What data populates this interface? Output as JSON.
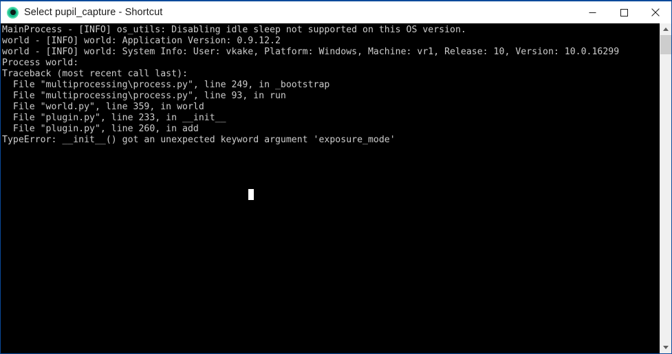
{
  "window": {
    "title": "Select pupil_capture - Shortcut",
    "icon": "pupil-circle-icon",
    "accent_border_color": "#0a4a9b",
    "titlebar_bg": "#ffffff",
    "console_bg": "#000000",
    "console_fg": "#cccccc"
  },
  "titlebar_buttons": {
    "minimize_label": "Minimize",
    "maximize_label": "Maximize",
    "close_label": "Close"
  },
  "console": {
    "lines": [
      "MainProcess - [INFO] os_utils: Disabling idle sleep not supported on this OS version.",
      "world - [INFO] world: Application Version: 0.9.12.2",
      "world - [INFO] world: System Info: User: vkake, Platform: Windows, Machine: vr1, Release: 10, Version: 10.0.16299",
      "Process world:",
      "Traceback (most recent call last):",
      "  File \"multiprocessing\\process.py\", line 249, in _bootstrap",
      "  File \"multiprocessing\\process.py\", line 93, in run",
      "  File \"world.py\", line 359, in world",
      "  File \"plugin.py\", line 233, in __init__",
      "  File \"plugin.py\", line 260, in add",
      "TypeError: __init__() got an unexpected keyword argument 'exposure_mode'"
    ],
    "cursor_visible": true
  },
  "scrollbar": {
    "up_arrow": "chevron-up-icon",
    "down_arrow": "chevron-down-icon",
    "thumb_color": "#cdcdcd",
    "track_color": "#f0f0f0"
  }
}
